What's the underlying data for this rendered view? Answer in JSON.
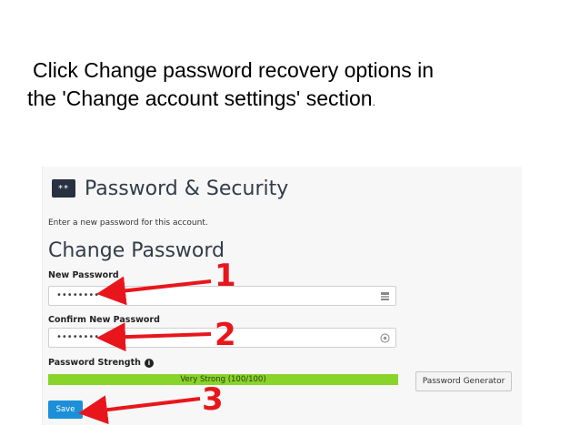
{
  "instruction": {
    "line1": "Click Change password recovery options in",
    "line2": "the 'Change account settings' section",
    "trailing_dot": "."
  },
  "header": {
    "icon_glyph": "**",
    "title": "Password & Security"
  },
  "hint": "Enter a new password for this account.",
  "form": {
    "title": "Change Password",
    "new_password": {
      "label": "New Password",
      "value": "••••••••••••",
      "icon": "generator-icon"
    },
    "confirm_password": {
      "label": "Confirm New Password",
      "value": "••••••••••••",
      "icon": "eye-icon"
    },
    "strength": {
      "label": "Password Strength",
      "info_glyph": "i",
      "bar_text": "Very Strong (100/100)",
      "score": 100,
      "color": "#88d42a"
    },
    "generator_label": "Password Generator",
    "save_label": "Save"
  },
  "annotations": {
    "color": "#e8161c",
    "steps": [
      "1",
      "2",
      "3"
    ]
  },
  "colors": {
    "header_icon_bg": "#273142",
    "save_bg": "#1c8fd9"
  }
}
